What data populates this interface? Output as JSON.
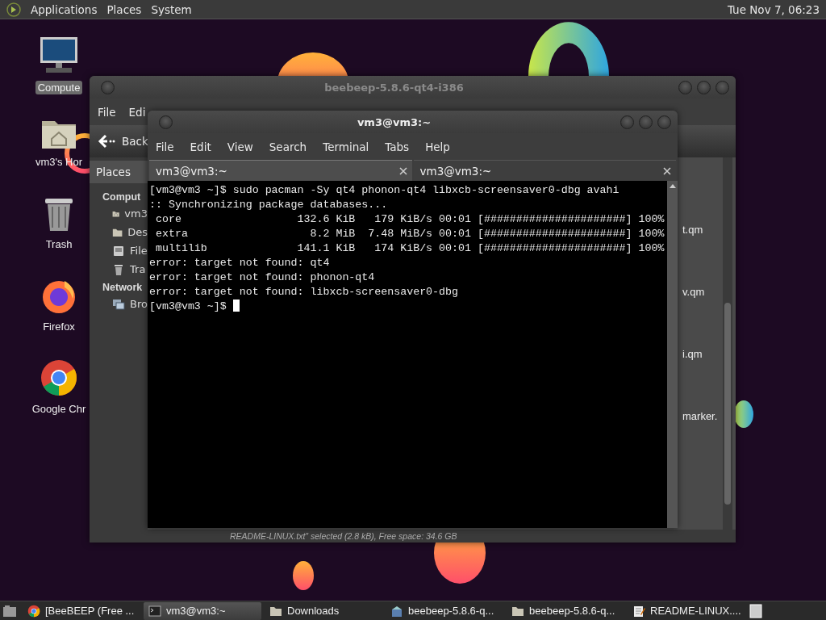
{
  "top_panel": {
    "menus": [
      "Applications",
      "Places",
      "System"
    ],
    "clock": "Tue Nov 7, 06:23"
  },
  "desktop_icons": [
    {
      "label": "Compute",
      "kind": "computer",
      "selected": true
    },
    {
      "label": "vm3's Hor",
      "kind": "home",
      "selected": false
    },
    {
      "label": "Trash",
      "kind": "trash",
      "selected": false
    },
    {
      "label": "Firefox",
      "kind": "firefox",
      "selected": false
    },
    {
      "label": "Google Chr",
      "kind": "chrome",
      "selected": false
    }
  ],
  "file_manager": {
    "title": "beebeep-5.8.6-qt4-i386",
    "menus": [
      "File",
      "Edi"
    ],
    "back": "Back",
    "sidebar_tab": "Places",
    "sidebar": [
      {
        "label": "Comput",
        "kind": "header"
      },
      {
        "label": "vm3",
        "kind": "home"
      },
      {
        "label": "Des",
        "kind": "folder"
      },
      {
        "label": "File",
        "kind": "drive"
      },
      {
        "label": "Tra",
        "kind": "trash"
      },
      {
        "label": "Network",
        "kind": "header"
      },
      {
        "label": "Bro",
        "kind": "network"
      }
    ],
    "files": [
      "t.qm",
      "v.qm",
      "i.qm",
      "marker."
    ],
    "status": "README-LINUX.txt\" selected (2.8 kB), Free space: 34.6 GB"
  },
  "terminal": {
    "title": "vm3@vm3:~",
    "menus": [
      "File",
      "Edit",
      "View",
      "Search",
      "Terminal",
      "Tabs",
      "Help"
    ],
    "tabs": [
      {
        "label": "vm3@vm3:~",
        "selected": true
      },
      {
        "label": "vm3@vm3:~",
        "selected": false
      }
    ],
    "lines": [
      "[vm3@vm3 ~]$ sudo pacman -Sy qt4 phonon-qt4 libxcb-screensaver0-dbg avahi",
      ":: Synchronizing package databases...",
      " core                  132.6 KiB   179 KiB/s 00:01 [######################] 100%",
      " extra                   8.2 MiB  7.48 MiB/s 00:01 [######################] 100%",
      " multilib              141.1 KiB   174 KiB/s 00:01 [######################] 100%",
      "error: target not found: qt4",
      "error: target not found: phonon-qt4",
      "error: target not found: libxcb-screensaver0-dbg",
      "[vm3@vm3 ~]$ "
    ]
  },
  "taskbar": {
    "items": [
      {
        "label": "[BeeBEEP (Free ...",
        "kind": "chrome",
        "selected": false
      },
      {
        "label": "vm3@vm3:~",
        "kind": "terminal",
        "selected": true
      },
      {
        "label": "Downloads",
        "kind": "folder",
        "selected": false
      },
      {
        "label": "beebeep-5.8.6-q...",
        "kind": "package",
        "selected": false
      },
      {
        "label": "beebeep-5.8.6-q...",
        "kind": "folder",
        "selected": false
      },
      {
        "label": "README-LINUX....",
        "kind": "editor",
        "selected": false
      }
    ]
  }
}
